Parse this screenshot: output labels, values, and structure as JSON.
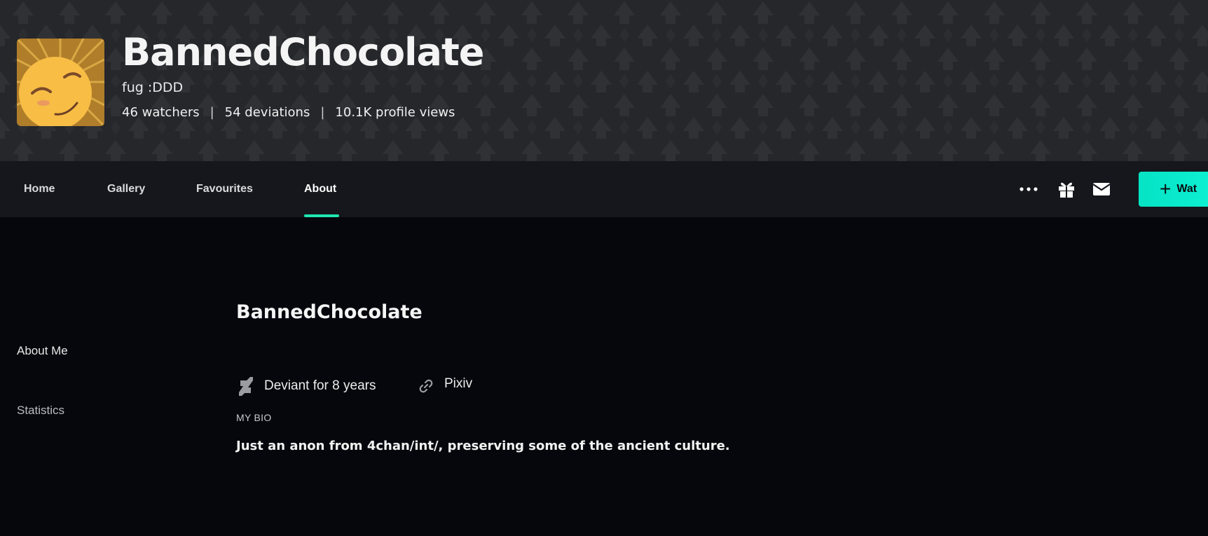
{
  "profile": {
    "name": "BannedChocolate",
    "tagline": "fug :DDD",
    "watchers": "46 watchers",
    "deviations": "54 deviations",
    "profile_views": "10.1K profile views",
    "separator": "|"
  },
  "nav": {
    "items": [
      {
        "label": "Home"
      },
      {
        "label": "Gallery"
      },
      {
        "label": "Favourites"
      },
      {
        "label": "About",
        "active": true
      }
    ],
    "icons": [
      "more-icon",
      "gift-icon",
      "mail-icon"
    ],
    "watch_label": "Wat",
    "accent": "#1ee6b0",
    "watch_color": "#05e3c4"
  },
  "sidebar": {
    "items": [
      {
        "label": "About Me"
      },
      {
        "label": "Statistics"
      }
    ]
  },
  "about": {
    "title": "BannedChocolate",
    "deviant_for": "Deviant for 8 years",
    "link_label": "Pixiv",
    "bio_label": "MY BIO",
    "bio_text": "Just an anon from 4chan/int/, preserving some of the ancient culture."
  }
}
